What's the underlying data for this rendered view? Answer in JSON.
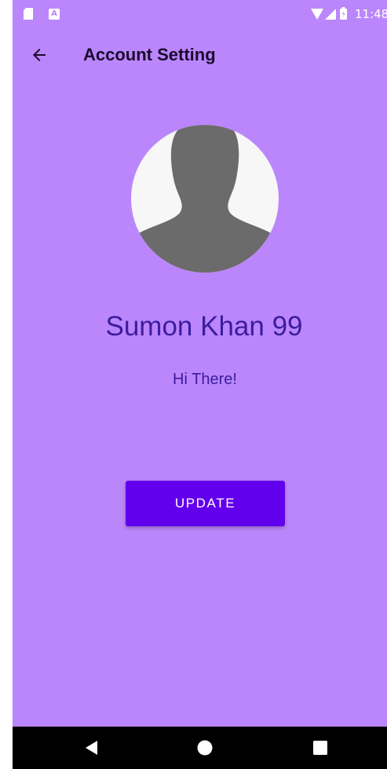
{
  "status_bar": {
    "time": "11:48",
    "icons": [
      "sd-card-icon",
      "a-notification-icon",
      "wifi-icon",
      "cell-signal-icon",
      "battery-icon"
    ],
    "a_icon_letter": "A"
  },
  "app_bar": {
    "title": "Account Setting",
    "back_icon": "arrow-left-icon"
  },
  "profile": {
    "avatar_icon": "person-silhouette-icon",
    "name": "Sumon Khan 99",
    "status": "Hi There!"
  },
  "actions": {
    "update_label": "UPDATE"
  },
  "nav_bar": {
    "icons": [
      "triangle-back-icon",
      "circle-home-icon",
      "square-recents-icon"
    ]
  },
  "colors": {
    "background": "#bb86fc",
    "primary": "#6200ee",
    "text_accent": "#3c1c9e",
    "title_text": "#1a0a2e",
    "avatar_bg": "#f7f7f7",
    "avatar_silhouette": "#6b6b6b",
    "nav_bar": "#000000"
  }
}
